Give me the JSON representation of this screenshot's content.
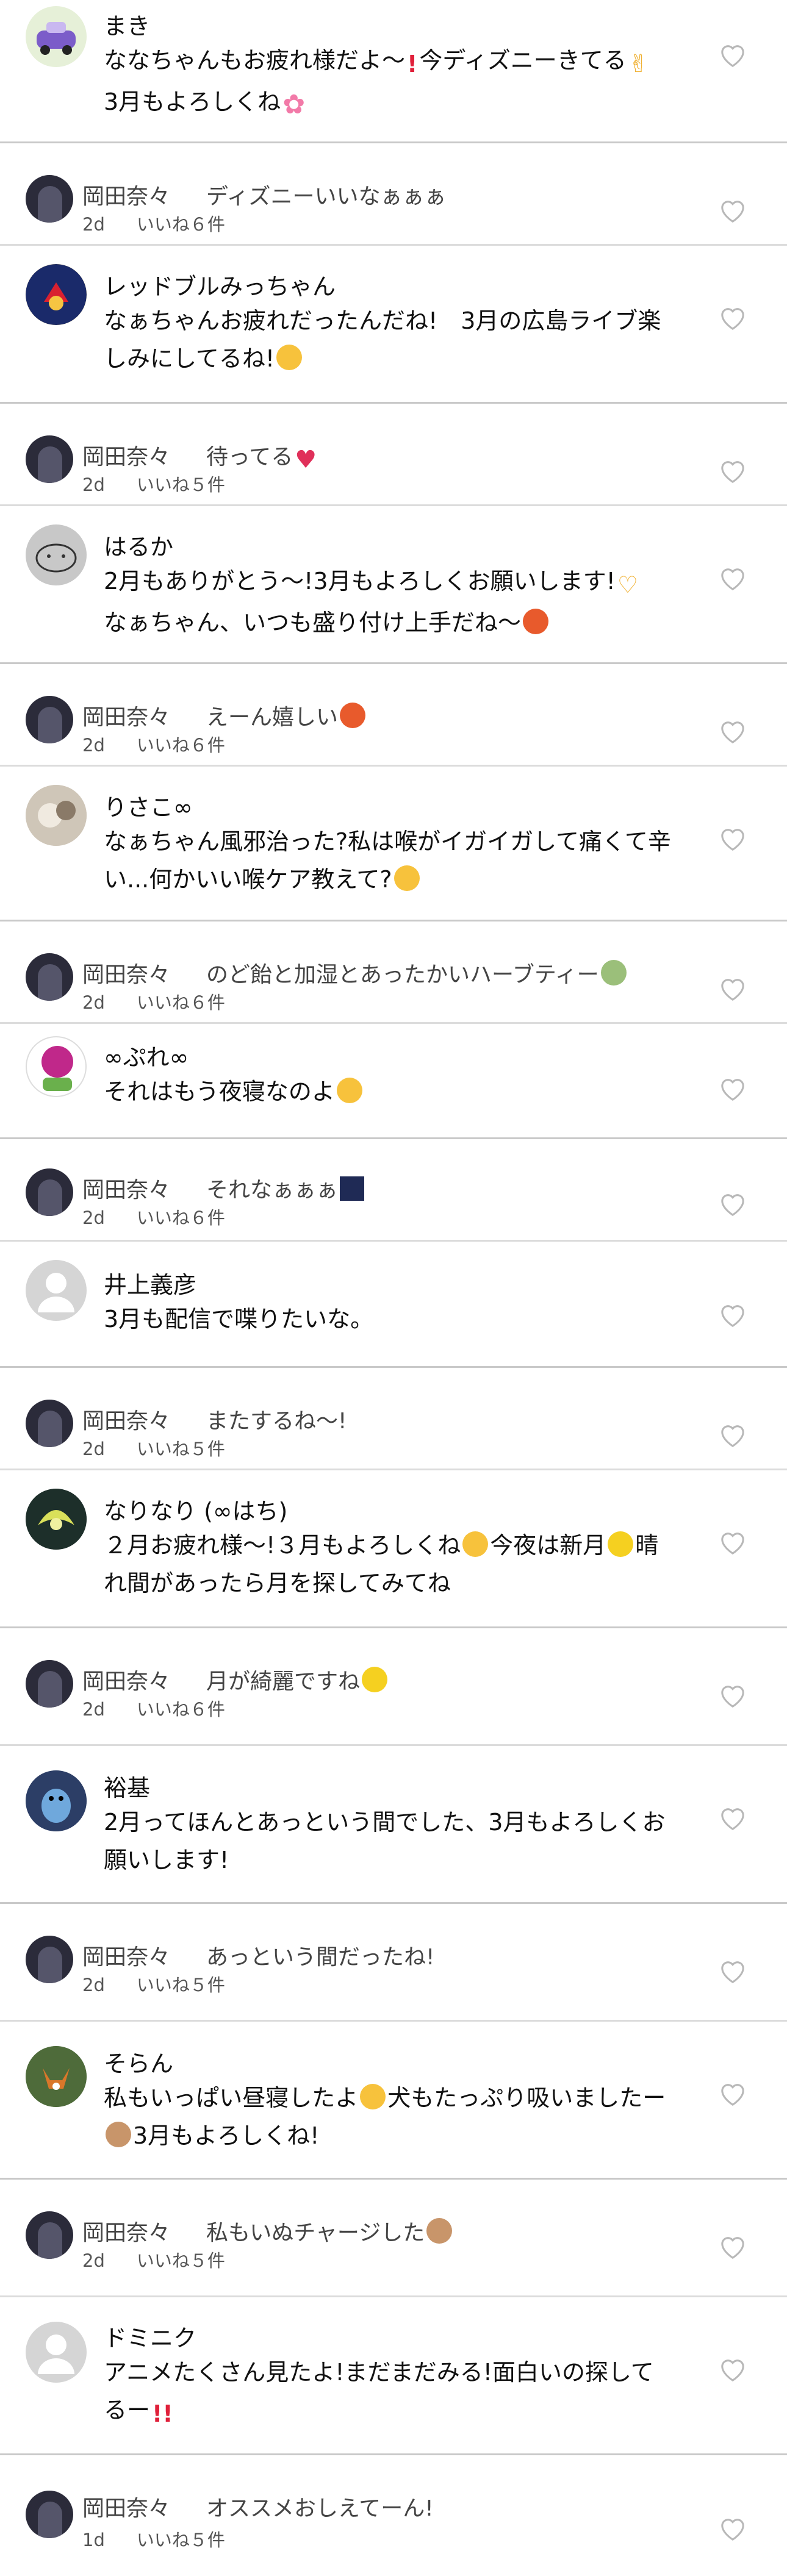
{
  "colors": {
    "divider": "#c9c9c9",
    "text": "#111111",
    "reply_text": "#444444",
    "meta": "#555555",
    "heart_outline": "#b8b8b8"
  },
  "icons": {
    "like": "heart-outline-icon",
    "default_avatar": "person-silhouette-icon"
  },
  "threads": [
    {
      "comment": {
        "user": "まき",
        "lines": [
          "ななちゃんもお疲れ様だよ～",
          "今ディズニーきてる",
          "3月もよろしくね"
        ],
        "avatar": "car-avatar"
      },
      "reply": {
        "user": "岡田奈々",
        "text": "ディズニーいいなぁぁぁ",
        "age": "2d",
        "likes": "いいね６件"
      }
    },
    {
      "comment": {
        "user": "レッドブルみっちゃん",
        "lines": [
          "なぁちゃんお疲れだったんだね!　3月の広島ライブ楽",
          "しみにしてるね!"
        ],
        "avatar": "redbull-avatar"
      },
      "reply": {
        "user": "岡田奈々",
        "text": "待ってる",
        "age": "2d",
        "likes": "いいね５件"
      }
    },
    {
      "comment": {
        "user": "はるか",
        "lines": [
          "2月もありがとう～!3月もよろしくお願いします!",
          "なぁちゃん、いつも盛り付け上手だね～"
        ],
        "avatar": "drawing-avatar"
      },
      "reply": {
        "user": "岡田奈々",
        "text": "えーん嬉しい",
        "age": "2d",
        "likes": "いいね６件"
      }
    },
    {
      "comment": {
        "user": "りさこ∞",
        "lines": [
          "なぁちゃん風邪治った?私は喉がイガイガして痛くて辛",
          "い...何かいい喉ケア教えて?"
        ],
        "avatar": "photo-avatar"
      },
      "reply": {
        "user": "岡田奈々",
        "text": "のど飴と加湿とあったかいハーブティー",
        "age": "2d",
        "likes": "いいね６件"
      }
    },
    {
      "comment": {
        "user": "∞ぷれ∞",
        "lines": [
          "それはもう夜寝なのよ"
        ],
        "avatar": "anime-avatar"
      },
      "reply": {
        "user": "岡田奈々",
        "text": "それなぁぁぁ",
        "age": "2d",
        "likes": "いいね６件"
      }
    },
    {
      "comment": {
        "user": "井上義彦",
        "lines": [
          "3月も配信で喋りたいな。"
        ],
        "avatar": "default-avatar"
      },
      "reply": {
        "user": "岡田奈々",
        "text": "またするね～!",
        "age": "2d",
        "likes": "いいね５件"
      }
    },
    {
      "comment": {
        "user": "なりなり (∞はち)",
        "lines": [
          "２月お疲れ様～!３月もよろしくね",
          "今夜は新月",
          "晴",
          "れ間があったら月を探してみてね"
        ],
        "avatar": "dragon-avatar"
      },
      "reply": {
        "user": "岡田奈々",
        "text": "月が綺麗ですね",
        "age": "2d",
        "likes": "いいね６件"
      }
    },
    {
      "comment": {
        "user": "裕基",
        "lines": [
          "2月ってほんとあっという間でした、3月もよろしくお",
          "願いします!"
        ],
        "avatar": "penguin-avatar"
      },
      "reply": {
        "user": "岡田奈々",
        "text": "あっという間だったね!",
        "age": "2d",
        "likes": "いいね５件"
      }
    },
    {
      "comment": {
        "user": "そらん",
        "lines": [
          "私もいっぱい昼寝したよ",
          "犬もたっぷり吸いましたー",
          "3月もよろしくね!"
        ],
        "avatar": "fox-avatar"
      },
      "reply": {
        "user": "岡田奈々",
        "text": "私もいぬチャージした",
        "age": "2d",
        "likes": "いいね５件"
      }
    },
    {
      "comment": {
        "user": "ドミニク",
        "lines": [
          "アニメたくさん見たよ!まだまだみる!面白いの探して",
          "るー"
        ],
        "avatar": "default-avatar"
      },
      "reply": {
        "user": "岡田奈々",
        "text": "オススメおしえてーん!",
        "age": "1d",
        "likes": "いいね５件"
      }
    }
  ]
}
